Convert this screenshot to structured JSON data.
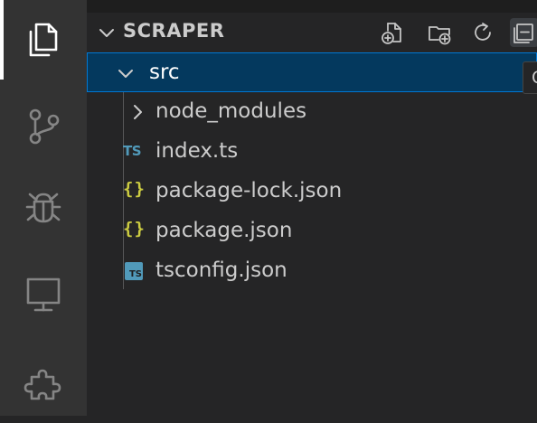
{
  "activity_bar": {
    "items": [
      {
        "name": "explorer",
        "icon": "files-icon",
        "active": true
      },
      {
        "name": "source-control",
        "icon": "source-control-icon",
        "active": false
      },
      {
        "name": "run-and-debug",
        "icon": "bug-icon",
        "active": false
      },
      {
        "name": "remote-explorer",
        "icon": "monitor-icon",
        "active": false
      },
      {
        "name": "extensions",
        "icon": "puzzle-icon",
        "active": false
      }
    ]
  },
  "explorer": {
    "title": "SCRAPER",
    "actions": [
      {
        "name": "new-file",
        "icon": "new-file-icon"
      },
      {
        "name": "new-folder",
        "icon": "new-folder-icon"
      },
      {
        "name": "refresh",
        "icon": "refresh-icon"
      },
      {
        "name": "collapse-all",
        "icon": "collapse-all-icon"
      }
    ],
    "tooltip_text": "C",
    "tree": [
      {
        "label": "src",
        "type": "folder",
        "expanded": true,
        "selected": true
      },
      {
        "label": "node_modules",
        "type": "folder",
        "expanded": false
      },
      {
        "label": "index.ts",
        "type": "ts-file",
        "icon_text": "TS"
      },
      {
        "label": "package-lock.json",
        "type": "json-file",
        "icon_text": "{}"
      },
      {
        "label": "package.json",
        "type": "json-file",
        "icon_text": "{}"
      },
      {
        "label": "tsconfig.json",
        "type": "tsconfig-file",
        "icon_text": "TS"
      }
    ]
  },
  "colors": {
    "activity_bg": "#333333",
    "sidebar_bg": "#252526",
    "selection_bg": "#04395e",
    "selection_border": "#0078d4",
    "ts_blue": "#519aba",
    "json_yellow": "#cbcb41"
  }
}
